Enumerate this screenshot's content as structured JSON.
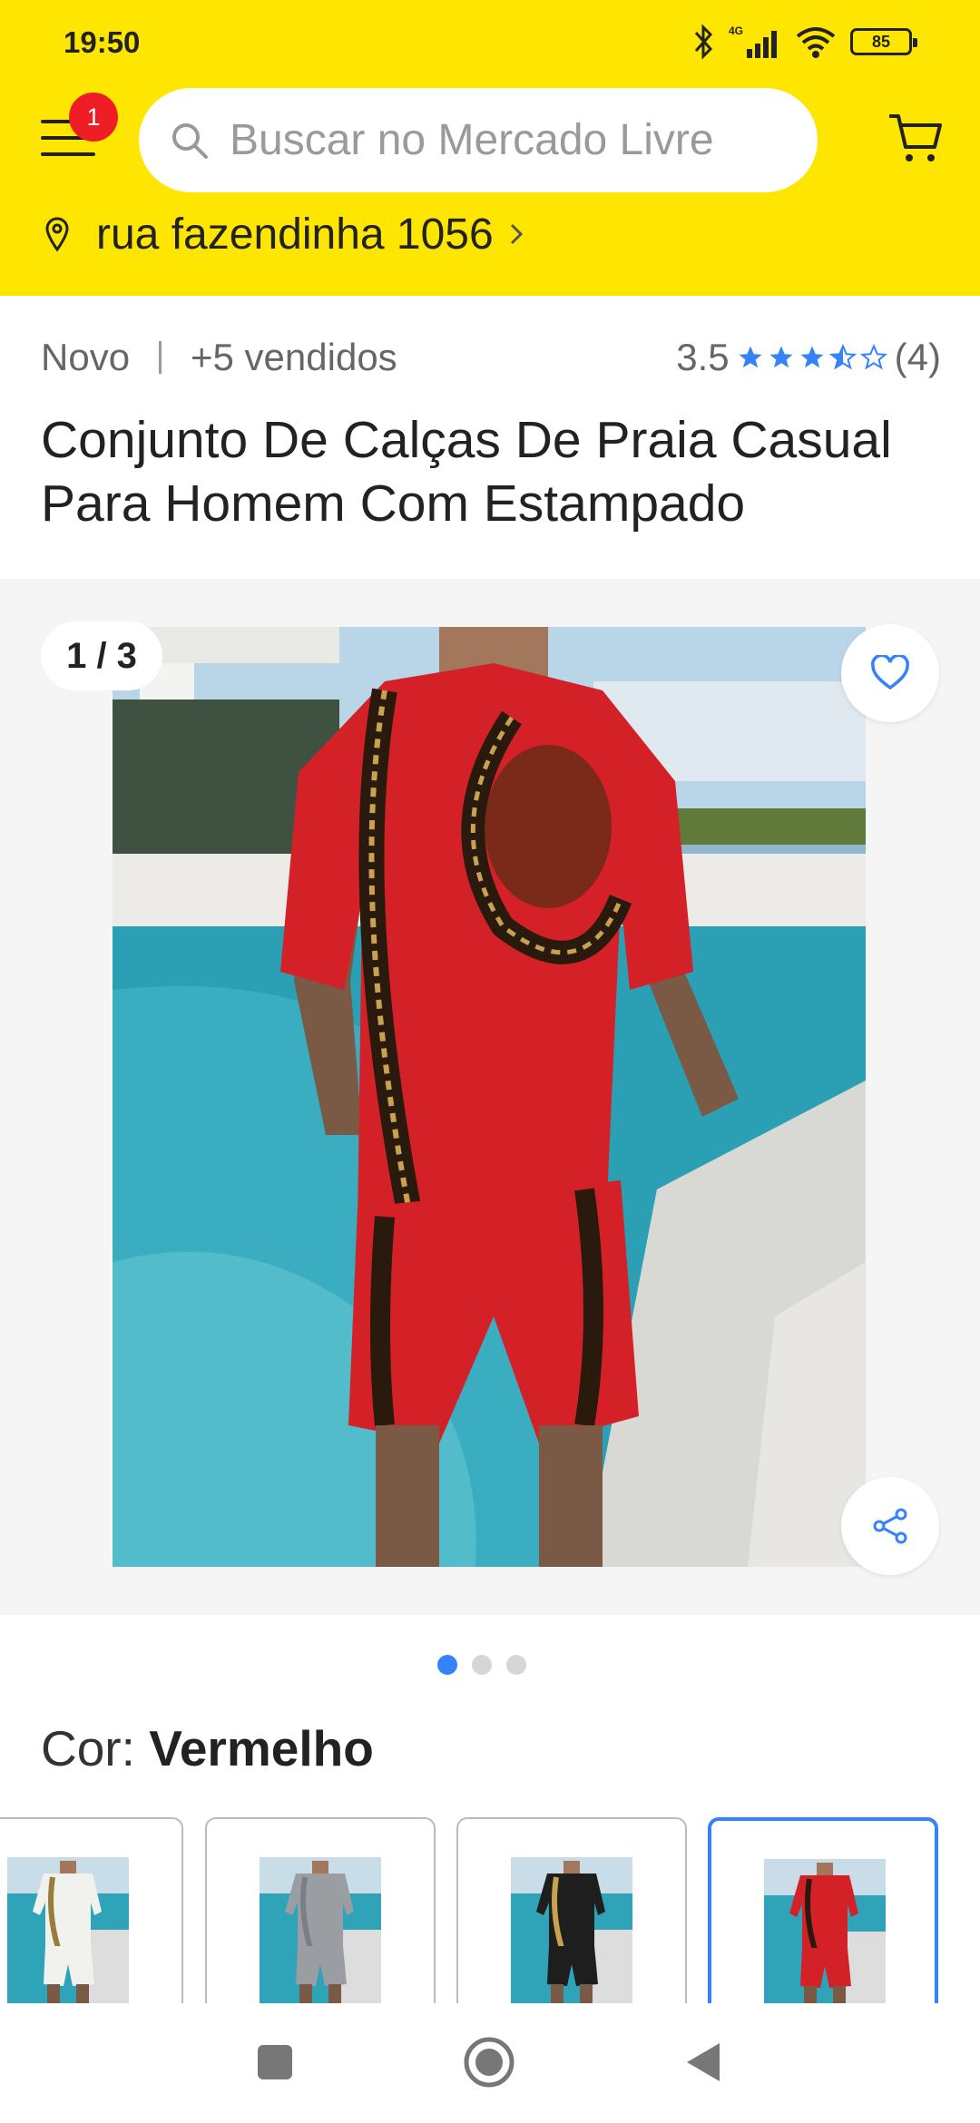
{
  "status": {
    "time": "19:50",
    "battery": "85",
    "network": "4G"
  },
  "header": {
    "notification_count": "1",
    "search_placeholder": "Buscar no Mercado Livre",
    "address": "rua fazendinha 1056"
  },
  "product": {
    "condition": "Novo",
    "sold": "+5 vendidos",
    "rating": "3.5",
    "rating_value": 3.5,
    "reviews": "(4)",
    "title": "Conjunto De Calças De Praia Casual Para Homem Com Estampado"
  },
  "gallery": {
    "counter": "1 / 3",
    "current": 1,
    "total": 3
  },
  "color": {
    "label": "Cor: ",
    "value": "Vermelho",
    "options": [
      {
        "name": "white-gold",
        "shirt": "#f1f1ee",
        "accent": "#9a7b3a"
      },
      {
        "name": "gray",
        "shirt": "#9a9ea3",
        "accent": "#7b7f85"
      },
      {
        "name": "black-gold",
        "shirt": "#1e1e1e",
        "accent": "#c8a251"
      },
      {
        "name": "red",
        "shirt": "#d42127",
        "accent": "#2a1a0e"
      }
    ],
    "selected_index": 3
  },
  "colors": {
    "brand_yellow": "#FFE600",
    "accent_blue": "#3483FA",
    "badge_red": "#EE1C25"
  }
}
